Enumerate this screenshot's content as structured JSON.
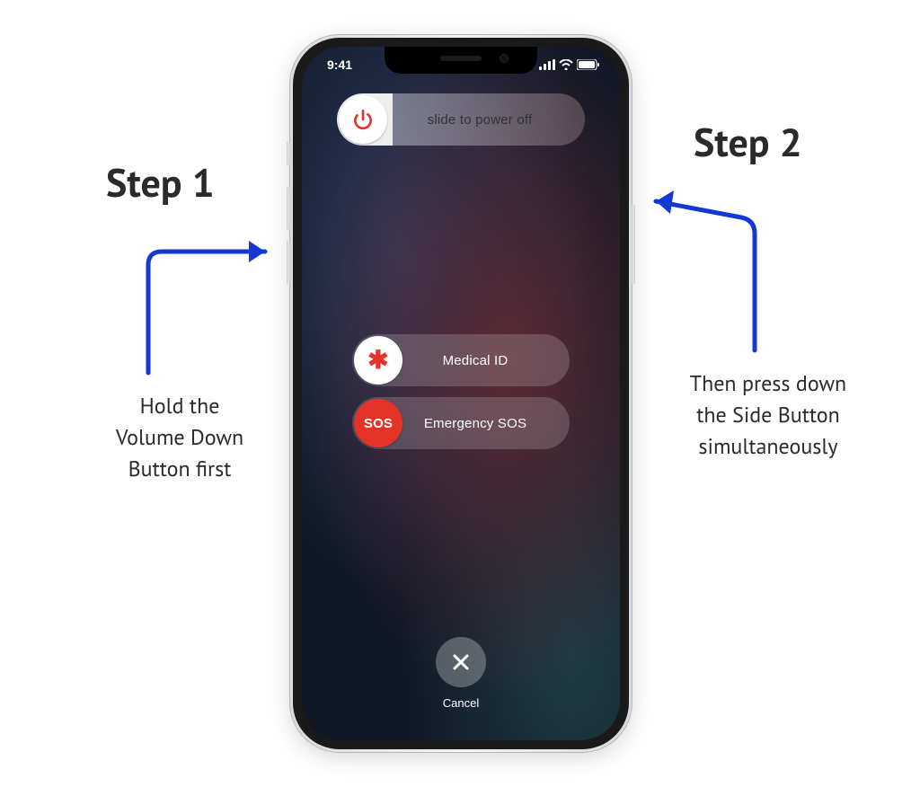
{
  "statusbar": {
    "time": "9:41"
  },
  "sliders": {
    "poweroff": {
      "label": "slide to power off"
    },
    "medical": {
      "label": "Medical ID",
      "knob_glyph": "✱"
    },
    "sos": {
      "label": "Emergency SOS",
      "knob_text": "SOS"
    }
  },
  "cancel": {
    "label": "Cancel"
  },
  "annotations": {
    "step1": {
      "heading": "Step 1",
      "body": "Hold the\nVolume Down\nButton first"
    },
    "step2": {
      "heading": "Step 2",
      "body": "Then press down\nthe Side Button\nsimultaneously"
    }
  },
  "colors": {
    "sos_red": "#e5332a",
    "arrow_blue": "#1338d6"
  }
}
